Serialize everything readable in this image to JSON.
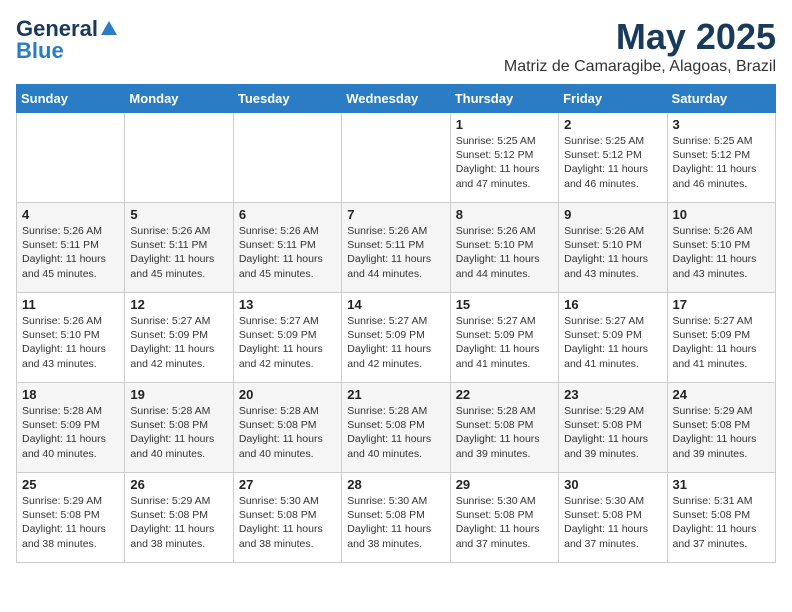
{
  "logo": {
    "line1": "General",
    "line2": "Blue"
  },
  "title": "May 2025",
  "subtitle": "Matriz de Camaragibe, Alagoas, Brazil",
  "days_of_week": [
    "Sunday",
    "Monday",
    "Tuesday",
    "Wednesday",
    "Thursday",
    "Friday",
    "Saturday"
  ],
  "weeks": [
    [
      {
        "day": "",
        "info": ""
      },
      {
        "day": "",
        "info": ""
      },
      {
        "day": "",
        "info": ""
      },
      {
        "day": "",
        "info": ""
      },
      {
        "day": "1",
        "info": "Sunrise: 5:25 AM\nSunset: 5:12 PM\nDaylight: 11 hours and 47 minutes."
      },
      {
        "day": "2",
        "info": "Sunrise: 5:25 AM\nSunset: 5:12 PM\nDaylight: 11 hours and 46 minutes."
      },
      {
        "day": "3",
        "info": "Sunrise: 5:25 AM\nSunset: 5:12 PM\nDaylight: 11 hours and 46 minutes."
      }
    ],
    [
      {
        "day": "4",
        "info": "Sunrise: 5:26 AM\nSunset: 5:11 PM\nDaylight: 11 hours and 45 minutes."
      },
      {
        "day": "5",
        "info": "Sunrise: 5:26 AM\nSunset: 5:11 PM\nDaylight: 11 hours and 45 minutes."
      },
      {
        "day": "6",
        "info": "Sunrise: 5:26 AM\nSunset: 5:11 PM\nDaylight: 11 hours and 45 minutes."
      },
      {
        "day": "7",
        "info": "Sunrise: 5:26 AM\nSunset: 5:11 PM\nDaylight: 11 hours and 44 minutes."
      },
      {
        "day": "8",
        "info": "Sunrise: 5:26 AM\nSunset: 5:10 PM\nDaylight: 11 hours and 44 minutes."
      },
      {
        "day": "9",
        "info": "Sunrise: 5:26 AM\nSunset: 5:10 PM\nDaylight: 11 hours and 43 minutes."
      },
      {
        "day": "10",
        "info": "Sunrise: 5:26 AM\nSunset: 5:10 PM\nDaylight: 11 hours and 43 minutes."
      }
    ],
    [
      {
        "day": "11",
        "info": "Sunrise: 5:26 AM\nSunset: 5:10 PM\nDaylight: 11 hours and 43 minutes."
      },
      {
        "day": "12",
        "info": "Sunrise: 5:27 AM\nSunset: 5:09 PM\nDaylight: 11 hours and 42 minutes."
      },
      {
        "day": "13",
        "info": "Sunrise: 5:27 AM\nSunset: 5:09 PM\nDaylight: 11 hours and 42 minutes."
      },
      {
        "day": "14",
        "info": "Sunrise: 5:27 AM\nSunset: 5:09 PM\nDaylight: 11 hours and 42 minutes."
      },
      {
        "day": "15",
        "info": "Sunrise: 5:27 AM\nSunset: 5:09 PM\nDaylight: 11 hours and 41 minutes."
      },
      {
        "day": "16",
        "info": "Sunrise: 5:27 AM\nSunset: 5:09 PM\nDaylight: 11 hours and 41 minutes."
      },
      {
        "day": "17",
        "info": "Sunrise: 5:27 AM\nSunset: 5:09 PM\nDaylight: 11 hours and 41 minutes."
      }
    ],
    [
      {
        "day": "18",
        "info": "Sunrise: 5:28 AM\nSunset: 5:09 PM\nDaylight: 11 hours and 40 minutes."
      },
      {
        "day": "19",
        "info": "Sunrise: 5:28 AM\nSunset: 5:08 PM\nDaylight: 11 hours and 40 minutes."
      },
      {
        "day": "20",
        "info": "Sunrise: 5:28 AM\nSunset: 5:08 PM\nDaylight: 11 hours and 40 minutes."
      },
      {
        "day": "21",
        "info": "Sunrise: 5:28 AM\nSunset: 5:08 PM\nDaylight: 11 hours and 40 minutes."
      },
      {
        "day": "22",
        "info": "Sunrise: 5:28 AM\nSunset: 5:08 PM\nDaylight: 11 hours and 39 minutes."
      },
      {
        "day": "23",
        "info": "Sunrise: 5:29 AM\nSunset: 5:08 PM\nDaylight: 11 hours and 39 minutes."
      },
      {
        "day": "24",
        "info": "Sunrise: 5:29 AM\nSunset: 5:08 PM\nDaylight: 11 hours and 39 minutes."
      }
    ],
    [
      {
        "day": "25",
        "info": "Sunrise: 5:29 AM\nSunset: 5:08 PM\nDaylight: 11 hours and 38 minutes."
      },
      {
        "day": "26",
        "info": "Sunrise: 5:29 AM\nSunset: 5:08 PM\nDaylight: 11 hours and 38 minutes."
      },
      {
        "day": "27",
        "info": "Sunrise: 5:30 AM\nSunset: 5:08 PM\nDaylight: 11 hours and 38 minutes."
      },
      {
        "day": "28",
        "info": "Sunrise: 5:30 AM\nSunset: 5:08 PM\nDaylight: 11 hours and 38 minutes."
      },
      {
        "day": "29",
        "info": "Sunrise: 5:30 AM\nSunset: 5:08 PM\nDaylight: 11 hours and 37 minutes."
      },
      {
        "day": "30",
        "info": "Sunrise: 5:30 AM\nSunset: 5:08 PM\nDaylight: 11 hours and 37 minutes."
      },
      {
        "day": "31",
        "info": "Sunrise: 5:31 AM\nSunset: 5:08 PM\nDaylight: 11 hours and 37 minutes."
      }
    ]
  ]
}
